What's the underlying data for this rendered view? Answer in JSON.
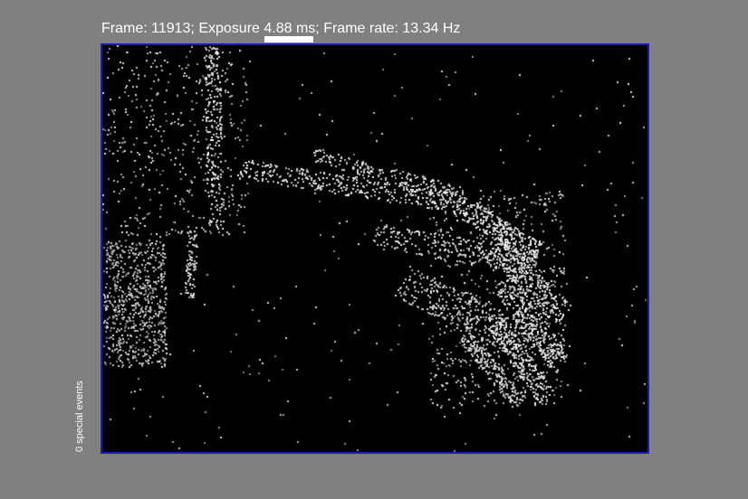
{
  "status_bar": {
    "frame_label": "Frame:",
    "frame_value": "11913;",
    "exposure_label": "Exposure",
    "exposure_value": "4.88 ms;",
    "frame_rate_label": "Frame rate:",
    "frame_rate_value": "13.34 Hz"
  },
  "side_label": {
    "special_events": "0 special events"
  },
  "colors": {
    "background": "#808080",
    "viewer_background": "#000000",
    "viewer_border": "#1b1bb8",
    "text": "#ffffff"
  },
  "viewer": {
    "content": "event-camera-frame-hand"
  }
}
